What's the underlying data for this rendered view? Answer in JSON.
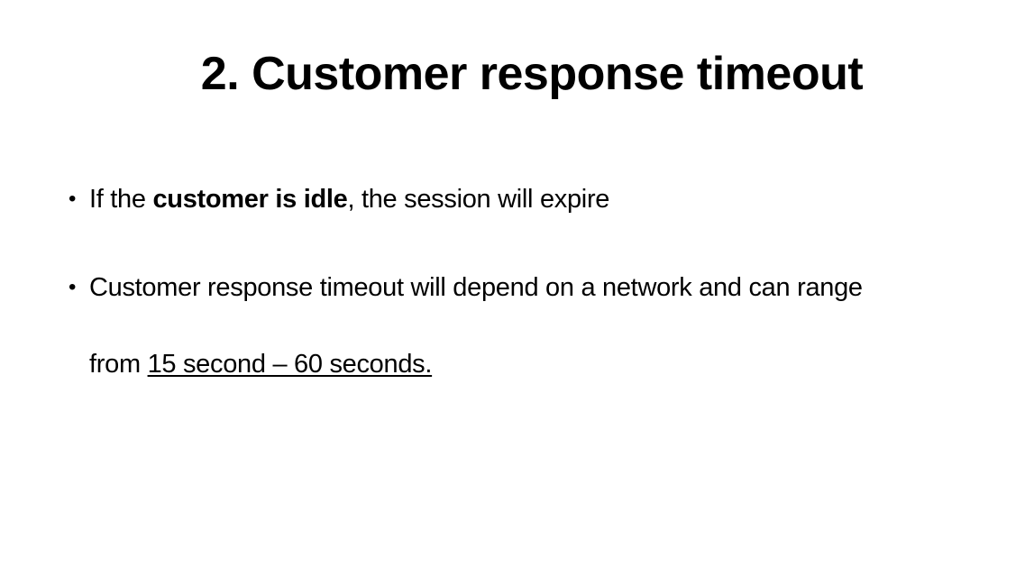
{
  "slide": {
    "title": "2. Customer response timeout",
    "bullets": [
      {
        "before": "If the ",
        "bold": "customer is idle",
        "after": ", the session will expire"
      },
      {
        "line1": "Customer response timeout will depend on a network and can range",
        "line2_before": "from ",
        "line2_underlined": "15 second – 60 seconds."
      }
    ],
    "bullet_symbol": "•"
  }
}
